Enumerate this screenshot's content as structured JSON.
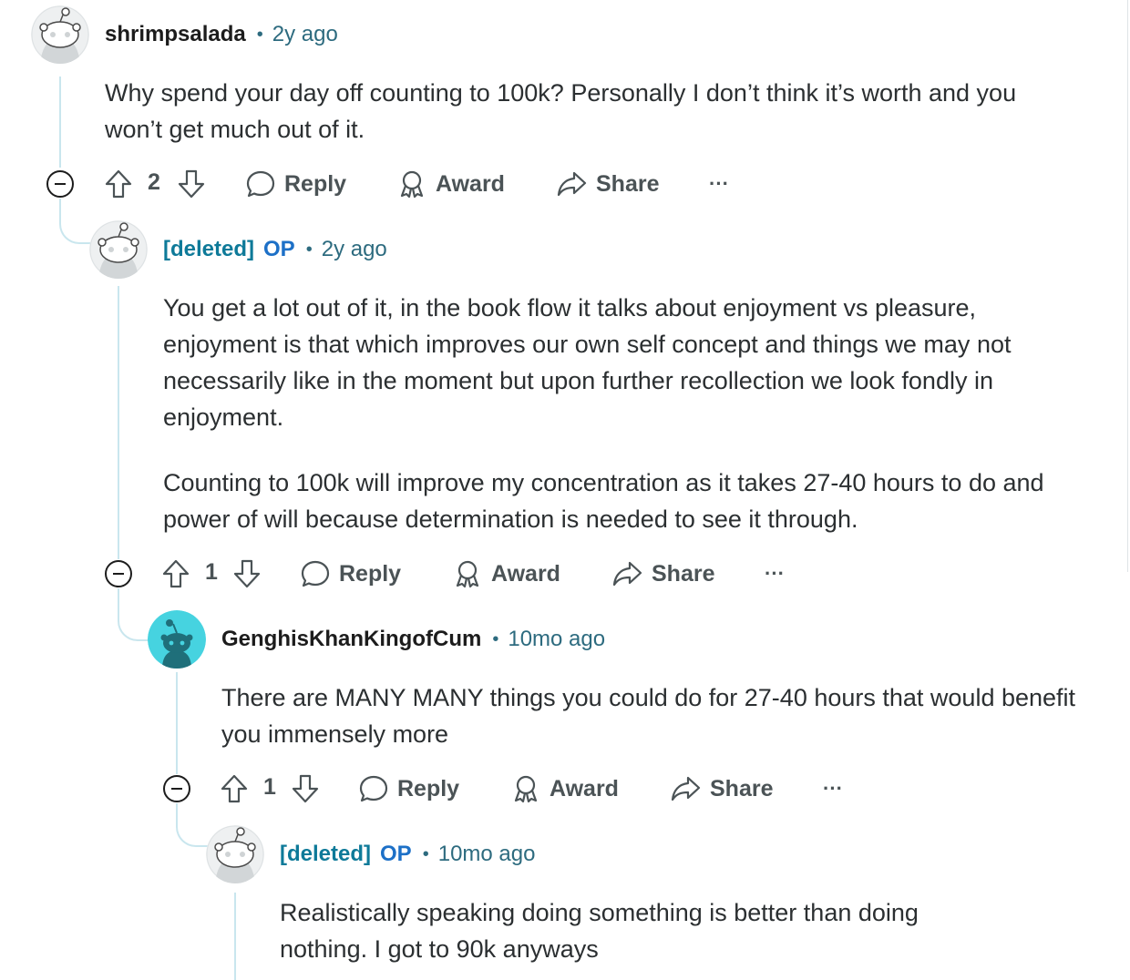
{
  "comments": [
    {
      "username": "shrimpsalada",
      "is_op": false,
      "time": "2y ago",
      "paragraphs": [
        "Why spend your day off counting to 100k? Personally I don’t think it’s worth and you won’t get much out of it."
      ],
      "score": "2",
      "reply_label": "Reply",
      "award_label": "Award",
      "share_label": "Share",
      "more_label": "···"
    },
    {
      "username": "[deleted]",
      "is_op": true,
      "op_label": "OP",
      "time": "2y ago",
      "paragraphs": [
        "You get a lot out of it, in the book flow it talks about enjoyment vs pleasure, enjoyment is that which improves our own self concept and things we may not necessarily like in the moment but upon further recollection we look fondly in enjoyment.",
        "Counting to 100k will improve my concentration as it takes 27-40 hours to do and power of will because determination is needed to see it through."
      ],
      "score": "1",
      "reply_label": "Reply",
      "award_label": "Award",
      "share_label": "Share",
      "more_label": "···"
    },
    {
      "username": "GenghisKhanKingofCum",
      "is_op": false,
      "time": "10mo ago",
      "paragraphs": [
        "There are MANY MANY things you could do for 27-40 hours that would benefit you immensely more"
      ],
      "score": "1",
      "reply_label": "Reply",
      "award_label": "Award",
      "share_label": "Share",
      "more_label": "···"
    },
    {
      "username": "[deleted]",
      "is_op": true,
      "op_label": "OP",
      "time": "10mo ago",
      "paragraphs": [
        "Realistically speaking doing something is better than doing nothing. I got to 90k anyways"
      ]
    }
  ],
  "separator": "•",
  "colors": {
    "thread_line": "#c9e6ee",
    "deleted_user": "#0e7a99",
    "op_badge": "#1d70c7",
    "meta_text": "#2d6b7f",
    "action_text": "#4b5356",
    "avatar_teal": "#46d3e0"
  },
  "icons": {
    "upvote": "arrow-up-outline-icon",
    "downvote": "arrow-down-outline-icon",
    "reply": "speech-bubble-icon",
    "award": "award-ribbon-icon",
    "share": "share-arrow-icon",
    "more": "ellipsis-icon",
    "collapse": "minus-circle-icon",
    "avatar_default": "snoo-gray-avatar-icon",
    "avatar_teal": "snoo-teal-avatar-icon"
  }
}
